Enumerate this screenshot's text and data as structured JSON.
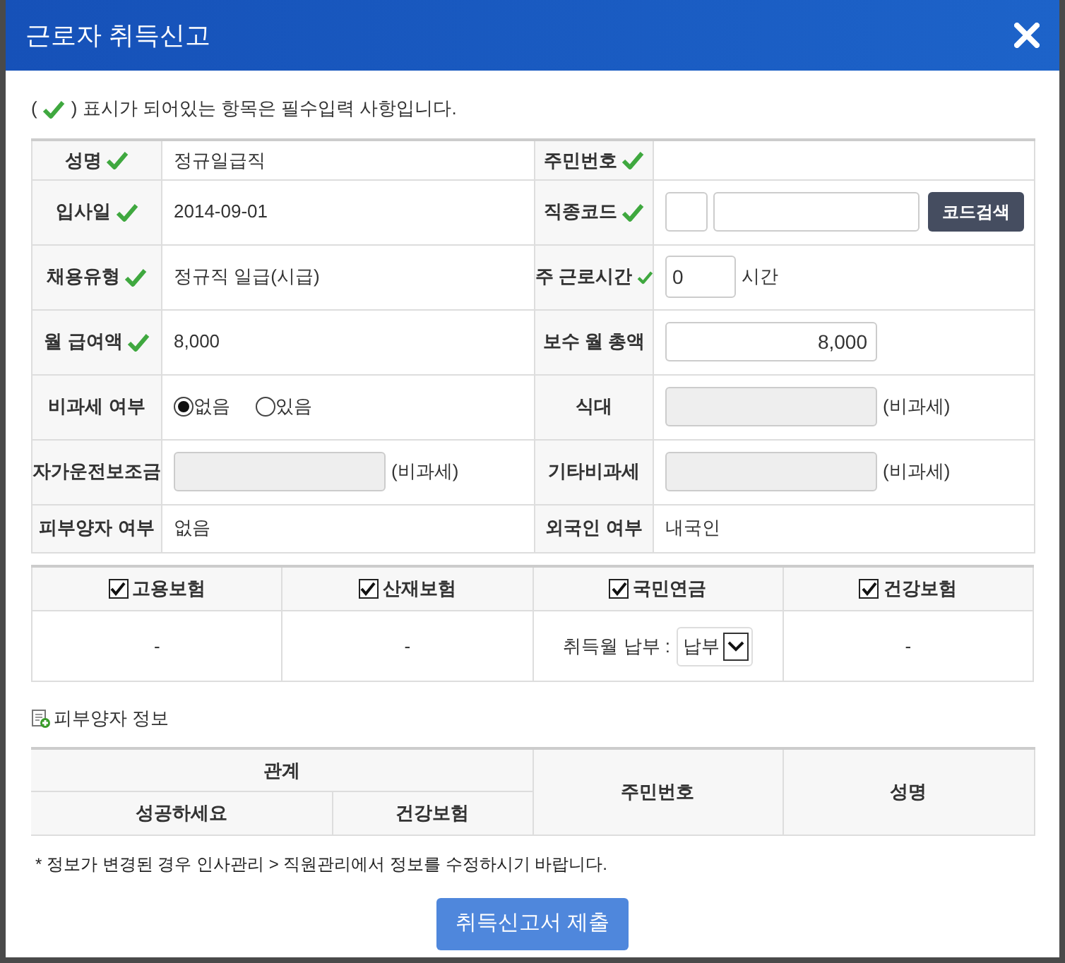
{
  "window": {
    "title": "근로자 취득신고"
  },
  "notice": {
    "open": "(",
    "text": ") 표시가 되어있는 항목은 필수입력 사항입니다."
  },
  "fields": [
    [
      {
        "label": "성명",
        "required": true,
        "kind": "text",
        "value": "정규일급직"
      },
      {
        "label": "주민번호",
        "required": true,
        "kind": "text"
      }
    ],
    [
      {
        "label": "입사일",
        "required": true,
        "kind": "text",
        "value": "2014-09-01"
      },
      {
        "label": "직종코드",
        "required": true,
        "kind": "code",
        "button": "코드검색"
      }
    ],
    [
      {
        "label": "채용유형",
        "required": true,
        "kind": "text",
        "value": "정규직 일급(시급)"
      },
      {
        "label": "주 근로시간",
        "required": true,
        "kind": "hours",
        "value": "0",
        "suffix": "시간"
      }
    ],
    [
      {
        "label": "월 급여액",
        "required": true,
        "kind": "text",
        "value": "8,000"
      },
      {
        "label": "보수 월 총액",
        "required": false,
        "kind": "amount",
        "value": "8,000"
      }
    ],
    [
      {
        "label": "비과세 여부",
        "required": false,
        "kind": "radio",
        "options": [
          {
            "label": "없음",
            "selected": true
          },
          {
            "label": "있음",
            "selected": false
          }
        ]
      },
      {
        "label": "식대",
        "required": false,
        "kind": "disabled",
        "suffix": "(비과세)"
      }
    ],
    [
      {
        "label": "자가운전보조금",
        "required": false,
        "kind": "disabled",
        "suffix": "(비과세)"
      },
      {
        "label": "기타비과세",
        "required": false,
        "kind": "disabled",
        "suffix": "(비과세)"
      }
    ],
    [
      {
        "label": "피부양자 여부",
        "required": false,
        "kind": "text",
        "value": "없음"
      },
      {
        "label": "외국인 여부",
        "required": false,
        "kind": "text",
        "value": "내국인"
      }
    ]
  ],
  "insurance": [
    {
      "label": "고용보험",
      "checked": true,
      "kind": "text",
      "value": "-"
    },
    {
      "label": "산재보험",
      "checked": true,
      "kind": "text",
      "value": "-"
    },
    {
      "label": "국민연금",
      "checked": true,
      "kind": "select",
      "prompt": "취득월 납부 :",
      "value": "납부"
    },
    {
      "label": "건강보험",
      "checked": true,
      "kind": "text",
      "value": "-"
    }
  ],
  "dependents": {
    "title": "피부양자 정보",
    "group": "관계",
    "subcolumns": [
      "성공하세요",
      "건강보험"
    ],
    "columns": [
      "주민번호",
      "성명"
    ]
  },
  "footnote": "* 정보가 변경된 경우 인사관리 > 직원관리에서 정보를 수정하시기 바랍니다.",
  "submit": "취득신고서 제출"
}
